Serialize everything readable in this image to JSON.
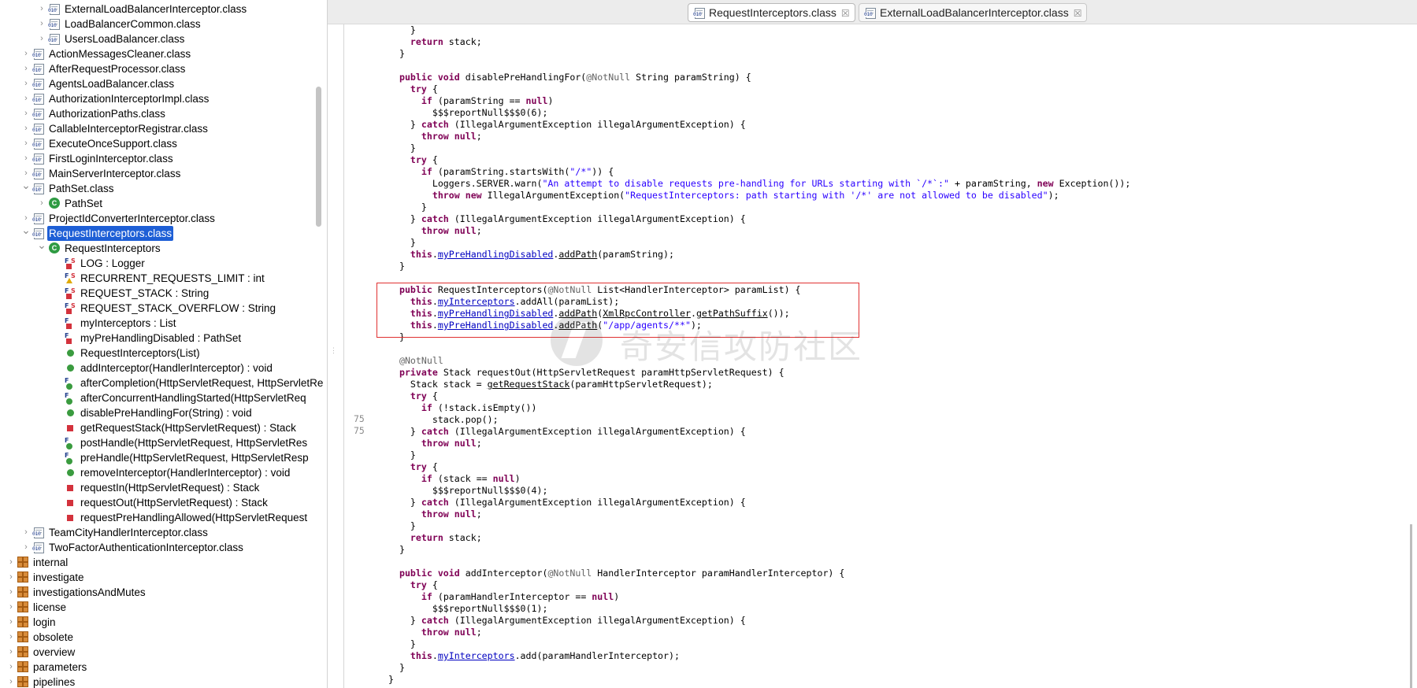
{
  "explorer": {
    "rows": [
      {
        "label": "ExternalLoadBalancerInterceptor.class",
        "depth": 2,
        "chevron": "right",
        "icon": "class-file"
      },
      {
        "label": "LoadBalancerCommon.class",
        "depth": 2,
        "chevron": "right",
        "icon": "class-file"
      },
      {
        "label": "UsersLoadBalancer.class",
        "depth": 2,
        "chevron": "right",
        "icon": "class-file"
      },
      {
        "label": "ActionMessagesCleaner.class",
        "depth": 1,
        "chevron": "right",
        "icon": "class-file"
      },
      {
        "label": "AfterRequestProcessor.class",
        "depth": 1,
        "chevron": "right",
        "icon": "class-file"
      },
      {
        "label": "AgentsLoadBalancer.class",
        "depth": 1,
        "chevron": "right",
        "icon": "class-file"
      },
      {
        "label": "AuthorizationInterceptorImpl.class",
        "depth": 1,
        "chevron": "right",
        "icon": "class-file"
      },
      {
        "label": "AuthorizationPaths.class",
        "depth": 1,
        "chevron": "right",
        "icon": "class-file"
      },
      {
        "label": "CallableInterceptorRegistrar.class",
        "depth": 1,
        "chevron": "right",
        "icon": "class-file"
      },
      {
        "label": "ExecuteOnceSupport.class",
        "depth": 1,
        "chevron": "right",
        "icon": "class-file"
      },
      {
        "label": "FirstLoginInterceptor.class",
        "depth": 1,
        "chevron": "right",
        "icon": "class-file"
      },
      {
        "label": "MainServerInterceptor.class",
        "depth": 1,
        "chevron": "right",
        "icon": "class-file"
      },
      {
        "label": "PathSet.class",
        "depth": 1,
        "chevron": "down",
        "icon": "class-file"
      },
      {
        "label": "PathSet",
        "depth": 2,
        "chevron": "right",
        "icon": "class"
      },
      {
        "label": "ProjectIdConverterInterceptor.class",
        "depth": 1,
        "chevron": "right",
        "icon": "class-file"
      },
      {
        "label": "RequestInterceptors.class",
        "depth": 1,
        "chevron": "down",
        "icon": "class-file",
        "selected": true
      },
      {
        "label": "RequestInterceptors",
        "depth": 2,
        "chevron": "down",
        "icon": "class"
      },
      {
        "label": "LOG : Logger",
        "depth": 3,
        "chevron": "",
        "icon": "final-static-field"
      },
      {
        "label": "RECURRENT_REQUESTS_LIMIT : int",
        "depth": 3,
        "chevron": "",
        "icon": "final-static-field-protected"
      },
      {
        "label": "REQUEST_STACK : String",
        "depth": 3,
        "chevron": "",
        "icon": "final-static-field"
      },
      {
        "label": "REQUEST_STACK_OVERFLOW : String",
        "depth": 3,
        "chevron": "",
        "icon": "final-static-field"
      },
      {
        "label": "myInterceptors : List",
        "depth": 3,
        "chevron": "",
        "icon": "final-field"
      },
      {
        "label": "myPreHandlingDisabled : PathSet",
        "depth": 3,
        "chevron": "",
        "icon": "final-field"
      },
      {
        "label": "RequestInterceptors(List)",
        "depth": 3,
        "chevron": "",
        "icon": "public-method"
      },
      {
        "label": "addInterceptor(HandlerInterceptor) : void",
        "depth": 3,
        "chevron": "",
        "icon": "public-method"
      },
      {
        "label": "afterCompletion(HttpServletRequest, HttpServletRe",
        "depth": 3,
        "chevron": "",
        "icon": "final-public-method"
      },
      {
        "label": "afterConcurrentHandlingStarted(HttpServletReq",
        "depth": 3,
        "chevron": "",
        "icon": "final-public-method"
      },
      {
        "label": "disablePreHandlingFor(String) : void",
        "depth": 3,
        "chevron": "",
        "icon": "public-method"
      },
      {
        "label": "getRequestStack(HttpServletRequest) : Stack",
        "depth": 3,
        "chevron": "",
        "icon": "private-method"
      },
      {
        "label": "postHandle(HttpServletRequest, HttpServletRes",
        "depth": 3,
        "chevron": "",
        "icon": "final-public-method"
      },
      {
        "label": "preHandle(HttpServletRequest, HttpServletResp",
        "depth": 3,
        "chevron": "",
        "icon": "final-public-method"
      },
      {
        "label": "removeInterceptor(HandlerInterceptor) : void",
        "depth": 3,
        "chevron": "",
        "icon": "public-method"
      },
      {
        "label": "requestIn(HttpServletRequest) : Stack",
        "depth": 3,
        "chevron": "",
        "icon": "private-method"
      },
      {
        "label": "requestOut(HttpServletRequest) : Stack",
        "depth": 3,
        "chevron": "",
        "icon": "private-method"
      },
      {
        "label": "requestPreHandlingAllowed(HttpServletRequest",
        "depth": 3,
        "chevron": "",
        "icon": "private-method"
      },
      {
        "label": "TeamCityHandlerInterceptor.class",
        "depth": 1,
        "chevron": "right",
        "icon": "class-file"
      },
      {
        "label": "TwoFactorAuthenticationInterceptor.class",
        "depth": 1,
        "chevron": "right",
        "icon": "class-file"
      },
      {
        "label": "internal",
        "depth": 0,
        "chevron": "right",
        "icon": "package"
      },
      {
        "label": "investigate",
        "depth": 0,
        "chevron": "right",
        "icon": "package"
      },
      {
        "label": "investigationsAndMutes",
        "depth": 0,
        "chevron": "right",
        "icon": "package"
      },
      {
        "label": "license",
        "depth": 0,
        "chevron": "right",
        "icon": "package"
      },
      {
        "label": "login",
        "depth": 0,
        "chevron": "right",
        "icon": "package"
      },
      {
        "label": "obsolete",
        "depth": 0,
        "chevron": "right",
        "icon": "package"
      },
      {
        "label": "overview",
        "depth": 0,
        "chevron": "right",
        "icon": "package"
      },
      {
        "label": "parameters",
        "depth": 0,
        "chevron": "right",
        "icon": "package"
      },
      {
        "label": "pipelines",
        "depth": 0,
        "chevron": "right",
        "icon": "package"
      }
    ]
  },
  "editor": {
    "tabs": [
      {
        "label": "RequestInterceptors.class",
        "active": true,
        "close": "☒"
      },
      {
        "label": "ExternalLoadBalancerInterceptor.class",
        "active": false,
        "close": "☒"
      }
    ],
    "line_numbers": [
      "75",
      "75"
    ],
    "watermark": "奇安信攻防社区",
    "lines": [
      [
        [
          "p",
          "    }"
        ]
      ],
      [
        [
          "p",
          "    "
        ],
        [
          "kw",
          "return"
        ],
        [
          "p",
          " stack;"
        ]
      ],
      [
        [
          "p",
          "  }"
        ]
      ],
      [
        [
          "p",
          ""
        ]
      ],
      [
        [
          "p",
          "  "
        ],
        [
          "kw",
          "public void"
        ],
        [
          "p",
          " disablePreHandlingFor("
        ],
        [
          "an",
          "@NotNull"
        ],
        [
          "p",
          " String paramString) {"
        ]
      ],
      [
        [
          "p",
          "    "
        ],
        [
          "kw",
          "try"
        ],
        [
          "p",
          " {"
        ]
      ],
      [
        [
          "p",
          "      "
        ],
        [
          "kw",
          "if"
        ],
        [
          "p",
          " (paramString == "
        ],
        [
          "kw",
          "null"
        ],
        [
          "p",
          ")"
        ]
      ],
      [
        [
          "p",
          "        $$$reportNull$$$0(6);"
        ]
      ],
      [
        [
          "p",
          "    } "
        ],
        [
          "kw",
          "catch"
        ],
        [
          "p",
          " (IllegalArgumentException illegalArgumentException) {"
        ]
      ],
      [
        [
          "p",
          "      "
        ],
        [
          "kw",
          "throw null"
        ],
        [
          "p",
          ";"
        ]
      ],
      [
        [
          "p",
          "    }"
        ]
      ],
      [
        [
          "p",
          "    "
        ],
        [
          "kw",
          "try"
        ],
        [
          "p",
          " {"
        ]
      ],
      [
        [
          "p",
          "      "
        ],
        [
          "kw",
          "if"
        ],
        [
          "p",
          " (paramString.startsWith("
        ],
        [
          "str",
          "\"/*\""
        ],
        [
          "p",
          ")) {"
        ]
      ],
      [
        [
          "p",
          "        Loggers.SERVER.warn("
        ],
        [
          "str",
          "\"An attempt to disable requests pre-handling for URLs starting with `/*`:\""
        ],
        [
          "p",
          " + paramString, "
        ],
        [
          "kw",
          "new"
        ],
        [
          "p",
          " Exception());"
        ]
      ],
      [
        [
          "p",
          "        "
        ],
        [
          "kw",
          "throw new"
        ],
        [
          "p",
          " IllegalArgumentException("
        ],
        [
          "str",
          "\"RequestInterceptors: path starting with '/*' are not allowed to be disabled\""
        ],
        [
          "p",
          ");"
        ]
      ],
      [
        [
          "p",
          "      }"
        ]
      ],
      [
        [
          "p",
          "    } "
        ],
        [
          "kw",
          "catch"
        ],
        [
          "p",
          " (IllegalArgumentException illegalArgumentException) {"
        ]
      ],
      [
        [
          "p",
          "      "
        ],
        [
          "kw",
          "throw null"
        ],
        [
          "p",
          ";"
        ]
      ],
      [
        [
          "p",
          "    }"
        ]
      ],
      [
        [
          "p",
          "    "
        ],
        [
          "kw",
          "this"
        ],
        [
          "p",
          "."
        ],
        [
          "fld",
          "myPreHandlingDisabled"
        ],
        [
          "p",
          "."
        ],
        [
          "mth",
          "addPath"
        ],
        [
          "p",
          "(paramString);"
        ]
      ],
      [
        [
          "p",
          "  }"
        ]
      ],
      [
        [
          "p",
          ""
        ]
      ],
      [
        [
          "p",
          "  "
        ],
        [
          "kw",
          "public"
        ],
        [
          "p",
          " RequestInterceptors("
        ],
        [
          "an",
          "@NotNull"
        ],
        [
          "p",
          " List<HandlerInterceptor> paramList) {"
        ]
      ],
      [
        [
          "p",
          "    "
        ],
        [
          "kw",
          "this"
        ],
        [
          "p",
          "."
        ],
        [
          "fld",
          "myInterceptors"
        ],
        [
          "p",
          ".addAll(paramList);"
        ]
      ],
      [
        [
          "p",
          "    "
        ],
        [
          "kw",
          "this"
        ],
        [
          "p",
          "."
        ],
        [
          "fld",
          "myPreHandlingDisabled"
        ],
        [
          "p",
          "."
        ],
        [
          "mth",
          "addPath"
        ],
        [
          "p",
          "("
        ],
        [
          "mth",
          "XmlRpcController"
        ],
        [
          "p",
          "."
        ],
        [
          "mth",
          "getPathSuffix"
        ],
        [
          "p",
          "());"
        ]
      ],
      [
        [
          "p",
          "    "
        ],
        [
          "kw",
          "this"
        ],
        [
          "p",
          "."
        ],
        [
          "fld",
          "myPreHandlingDisabled"
        ],
        [
          "p",
          "."
        ],
        [
          "mth",
          "addPath"
        ],
        [
          "p",
          "("
        ],
        [
          "str",
          "\"/app/agents/**\""
        ],
        [
          "p",
          ");"
        ]
      ],
      [
        [
          "p",
          "  }"
        ]
      ],
      [
        [
          "p",
          ""
        ]
      ],
      [
        [
          "p",
          "  "
        ],
        [
          "an",
          "@NotNull"
        ]
      ],
      [
        [
          "p",
          "  "
        ],
        [
          "kw",
          "private"
        ],
        [
          "p",
          " Stack requestOut(HttpServletRequest paramHttpServletRequest) {"
        ]
      ],
      [
        [
          "p",
          "    Stack stack = "
        ],
        [
          "mth",
          "getRequestStack"
        ],
        [
          "p",
          "(paramHttpServletRequest);"
        ]
      ],
      [
        [
          "p",
          "    "
        ],
        [
          "kw",
          "try"
        ],
        [
          "p",
          " {"
        ]
      ],
      [
        [
          "p",
          "      "
        ],
        [
          "kw",
          "if"
        ],
        [
          "p",
          " (!stack.isEmpty())"
        ]
      ],
      [
        [
          "p",
          "        stack.pop();"
        ]
      ],
      [
        [
          "p",
          "    } "
        ],
        [
          "kw",
          "catch"
        ],
        [
          "p",
          " (IllegalArgumentException illegalArgumentException) {"
        ]
      ],
      [
        [
          "p",
          "      "
        ],
        [
          "kw",
          "throw null"
        ],
        [
          "p",
          ";"
        ]
      ],
      [
        [
          "p",
          "    }"
        ]
      ],
      [
        [
          "p",
          "    "
        ],
        [
          "kw",
          "try"
        ],
        [
          "p",
          " {"
        ]
      ],
      [
        [
          "p",
          "      "
        ],
        [
          "kw",
          "if"
        ],
        [
          "p",
          " (stack == "
        ],
        [
          "kw",
          "null"
        ],
        [
          "p",
          ")"
        ]
      ],
      [
        [
          "p",
          "        $$$reportNull$$$0(4);"
        ]
      ],
      [
        [
          "p",
          "    } "
        ],
        [
          "kw",
          "catch"
        ],
        [
          "p",
          " (IllegalArgumentException illegalArgumentException) {"
        ]
      ],
      [
        [
          "p",
          "      "
        ],
        [
          "kw",
          "throw null"
        ],
        [
          "p",
          ";"
        ]
      ],
      [
        [
          "p",
          "    }"
        ]
      ],
      [
        [
          "p",
          "    "
        ],
        [
          "kw",
          "return"
        ],
        [
          "p",
          " stack;"
        ]
      ],
      [
        [
          "p",
          "  }"
        ]
      ],
      [
        [
          "p",
          ""
        ]
      ],
      [
        [
          "p",
          "  "
        ],
        [
          "kw",
          "public void"
        ],
        [
          "p",
          " addInterceptor("
        ],
        [
          "an",
          "@NotNull"
        ],
        [
          "p",
          " HandlerInterceptor paramHandlerInterceptor) {"
        ]
      ],
      [
        [
          "p",
          "    "
        ],
        [
          "kw",
          "try"
        ],
        [
          "p",
          " {"
        ]
      ],
      [
        [
          "p",
          "      "
        ],
        [
          "kw",
          "if"
        ],
        [
          "p",
          " (paramHandlerInterceptor == "
        ],
        [
          "kw",
          "null"
        ],
        [
          "p",
          ")"
        ]
      ],
      [
        [
          "p",
          "        $$$reportNull$$$0(1);"
        ]
      ],
      [
        [
          "p",
          "    } "
        ],
        [
          "kw",
          "catch"
        ],
        [
          "p",
          " (IllegalArgumentException illegalArgumentException) {"
        ]
      ],
      [
        [
          "p",
          "      "
        ],
        [
          "kw",
          "throw null"
        ],
        [
          "p",
          ";"
        ]
      ],
      [
        [
          "p",
          "    }"
        ]
      ],
      [
        [
          "p",
          "    "
        ],
        [
          "kw",
          "this"
        ],
        [
          "p",
          "."
        ],
        [
          "fld",
          "myInterceptors"
        ],
        [
          "p",
          ".add(paramHandlerInterceptor);"
        ]
      ],
      [
        [
          "p",
          "  }"
        ]
      ],
      [
        [
          "p",
          "}"
        ]
      ]
    ]
  }
}
